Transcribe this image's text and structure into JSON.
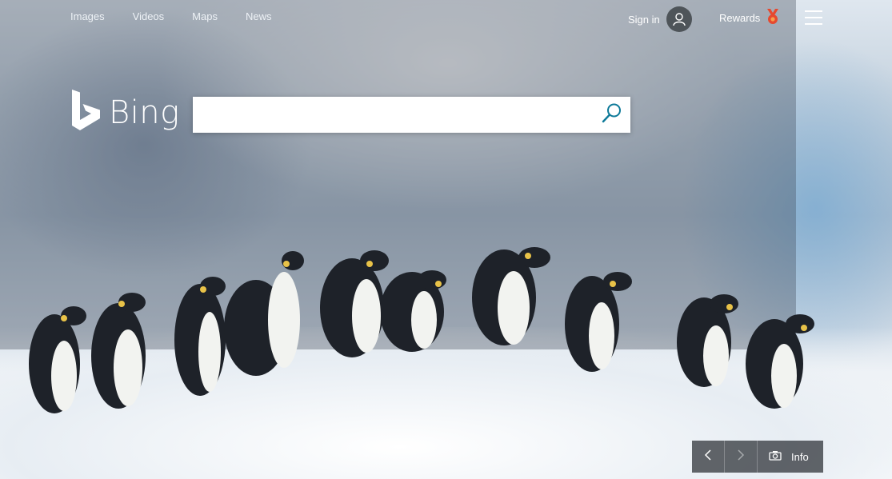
{
  "nav": {
    "links": [
      "Images",
      "Videos",
      "Maps",
      "News"
    ]
  },
  "header": {
    "signin_label": "Sign in",
    "rewards_label": "Rewards"
  },
  "logo": {
    "text": "Bing"
  },
  "search": {
    "placeholder": "",
    "value": ""
  },
  "controls": {
    "info_label": "Info"
  },
  "colors": {
    "accent": "#0e7a99",
    "rewards_medal": "#e6492f",
    "avatar_bg": "#4e5459"
  },
  "icons": [
    "user-icon",
    "rewards-medal-icon",
    "hamburger-menu-icon",
    "bing-logo-icon",
    "search-icon",
    "chevron-left-icon",
    "chevron-right-icon",
    "camera-icon"
  ]
}
